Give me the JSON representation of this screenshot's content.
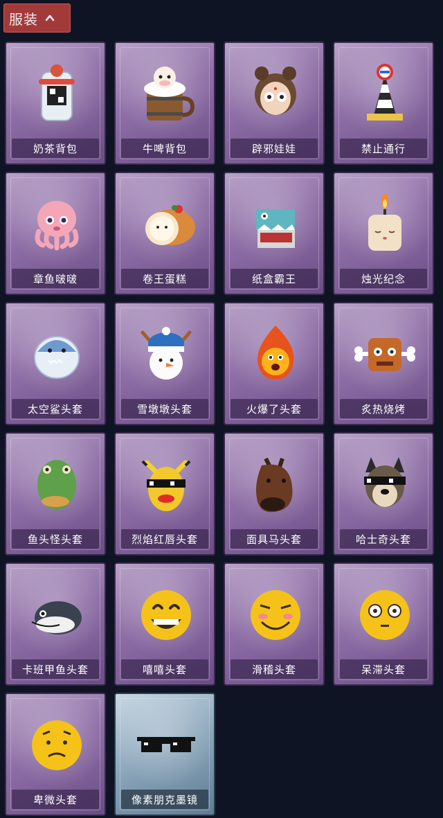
{
  "header": {
    "title": "服装",
    "toggle_icon": "chevron-up-icon"
  },
  "items": [
    {
      "label": "奶茶背包",
      "icon": "milk-tea-backpack-icon",
      "theme": "purple"
    },
    {
      "label": "牛啤背包",
      "icon": "cow-beer-barrel-icon",
      "theme": "purple"
    },
    {
      "label": "辟邪娃娃",
      "icon": "doll-head-icon",
      "theme": "purple"
    },
    {
      "label": "禁止通行",
      "icon": "traffic-cone-icon",
      "theme": "purple"
    },
    {
      "label": "章鱼啵啵",
      "icon": "octopus-icon",
      "theme": "purple"
    },
    {
      "label": "卷王蛋糕",
      "icon": "roll-cake-icon",
      "theme": "purple"
    },
    {
      "label": "纸盒霸王",
      "icon": "box-dinosaur-icon",
      "theme": "purple"
    },
    {
      "label": "烛光纪念",
      "icon": "candle-icon",
      "theme": "purple"
    },
    {
      "label": "太空鲨头套",
      "icon": "space-shark-icon",
      "theme": "purple"
    },
    {
      "label": "雪墩墩头套",
      "icon": "snowman-icon",
      "theme": "purple"
    },
    {
      "label": "火爆了头套",
      "icon": "fireball-icon",
      "theme": "purple"
    },
    {
      "label": "炙热烧烤",
      "icon": "grilled-meat-icon",
      "theme": "purple"
    },
    {
      "label": "鱼头怪头套",
      "icon": "fish-head-icon",
      "theme": "purple"
    },
    {
      "label": "烈焰红唇头套",
      "icon": "red-lips-mask-icon",
      "theme": "purple"
    },
    {
      "label": "面具马头套",
      "icon": "horse-mask-icon",
      "theme": "purple"
    },
    {
      "label": "哈士奇头套",
      "icon": "husky-mask-icon",
      "theme": "purple"
    },
    {
      "label": "卡班甲鱼头套",
      "icon": "turtle-head-icon",
      "theme": "purple"
    },
    {
      "label": "嘻嘻头套",
      "icon": "grin-emoji-icon",
      "theme": "purple"
    },
    {
      "label": "滑稽头套",
      "icon": "smirk-emoji-icon",
      "theme": "purple"
    },
    {
      "label": "呆滞头套",
      "icon": "dazed-emoji-icon",
      "theme": "purple"
    },
    {
      "label": "卑微头套",
      "icon": "humble-emoji-icon",
      "theme": "purple"
    },
    {
      "label": "像素朋克墨镜",
      "icon": "pixel-sunglasses-icon",
      "theme": "blue"
    }
  ]
}
